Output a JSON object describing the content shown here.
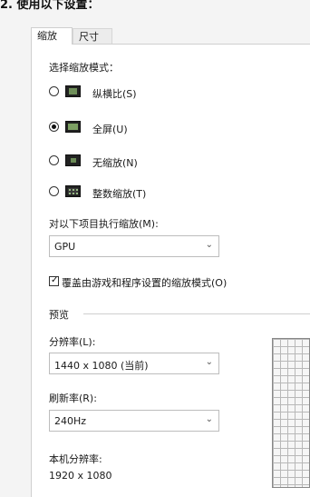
{
  "heading": "2. 使用以下设置：",
  "tabs": [
    {
      "label": "缩放",
      "active": true
    },
    {
      "label": "尺寸",
      "active": false
    }
  ],
  "scaling_mode": {
    "title": "选择缩放模式：",
    "options": [
      {
        "label": "纵横比(S)",
        "icon": "aspect-ratio-icon",
        "checked": false
      },
      {
        "label": "全屏(U)",
        "icon": "fullscreen-icon",
        "checked": true
      },
      {
        "label": "无缩放(N)",
        "icon": "no-scaling-icon",
        "checked": false
      },
      {
        "label": "整数缩放(T)",
        "icon": "integer-scaling-icon",
        "checked": false
      }
    ]
  },
  "perform_scaling": {
    "label": "对以下项目执行缩放(M):",
    "value": "GPU"
  },
  "override_checkbox": {
    "label": "覆盖由游戏和程序设置的缩放模式(O)",
    "checked": true
  },
  "preview": {
    "section_label": "预览",
    "resolution_label": "分辨率(L):",
    "resolution_value": "1440 x 1080 (当前)",
    "refresh_label": "刷新率(R):",
    "refresh_value": "240Hz",
    "native_label": "本机分辨率:",
    "native_value": "1920 x 1080"
  }
}
